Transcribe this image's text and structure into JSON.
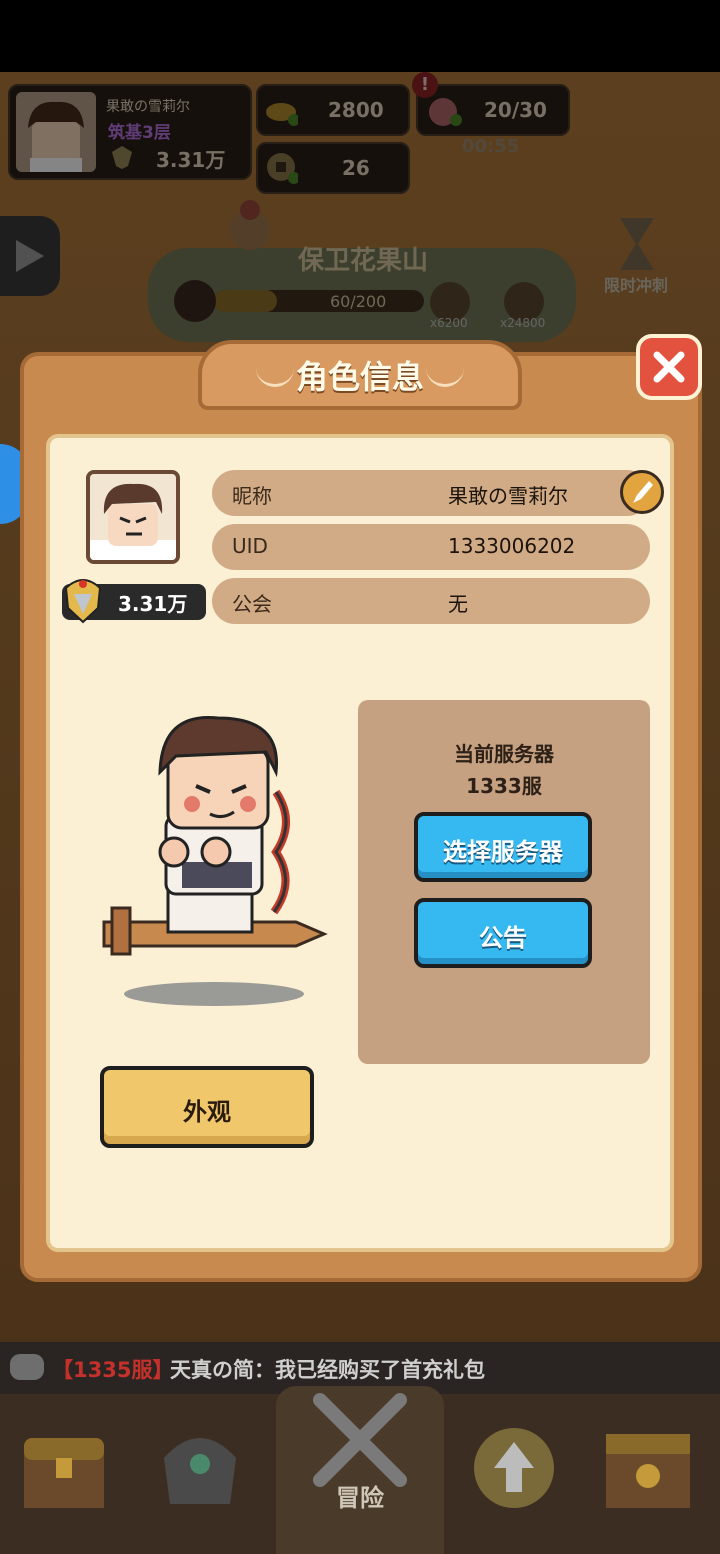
{
  "hud": {
    "player_name": "果敢の雪莉尔",
    "realm": "筑基3层",
    "power": "3.31万",
    "gold": "2800",
    "stamina": "20/30",
    "timer": "00:55",
    "coins": "26"
  },
  "event": {
    "title": "保卫花果山",
    "progress_text": "60/200",
    "progress": 0.3,
    "reward_1": "x6200",
    "reward_2": "x24800",
    "limited_label": "限时冲刺"
  },
  "modal": {
    "title": "角色信息",
    "rows": [
      {
        "label": "昵称",
        "value": "果敢の雪莉尔"
      },
      {
        "label": "UID",
        "value": "1333006202"
      },
      {
        "label": "公会",
        "value": "无"
      }
    ],
    "power": "3.31万",
    "server_label": "当前服务器",
    "server_value": "1333服",
    "select_server_label": "选择服务器",
    "notice_label": "公告",
    "appearance_label": "外观"
  },
  "chat": {
    "server_tag": "【1335服】",
    "message": "天真の简：我已经购买了首充礼包"
  },
  "nav": {
    "adventure_label": "冒险"
  },
  "colors": {
    "accent_blue": "#35b9f0",
    "accent_yellow": "#f1c76c",
    "close_red": "#e2523e"
  }
}
